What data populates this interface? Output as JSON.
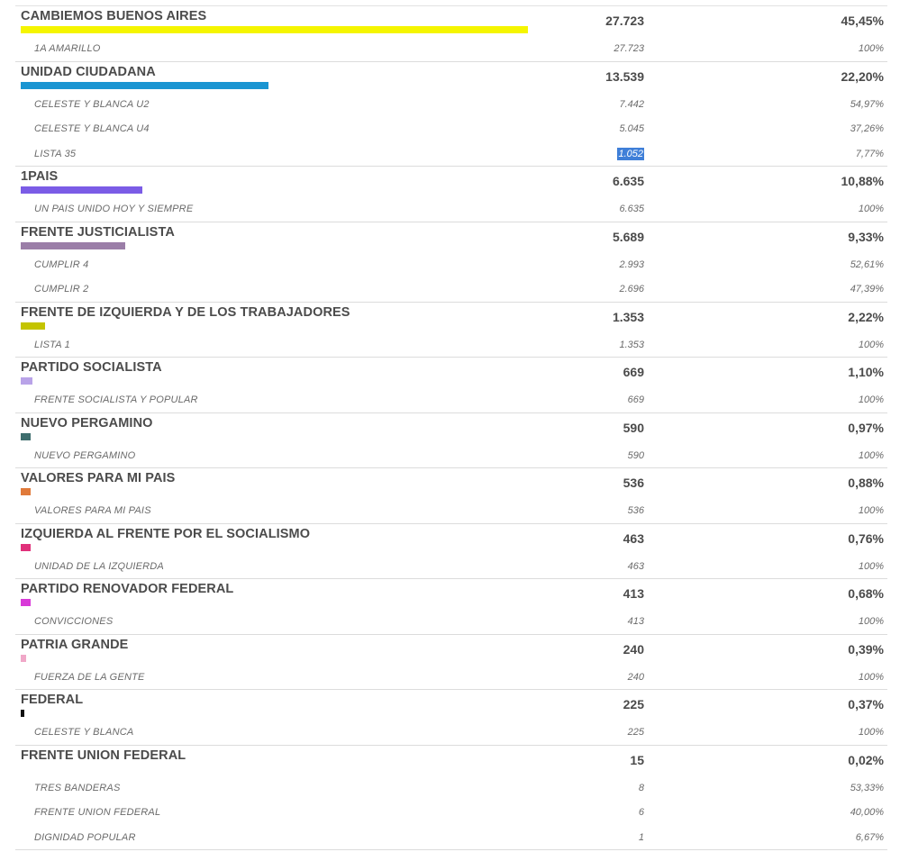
{
  "results": {
    "parties": [
      {
        "name": "CAMBIEMOS BUENOS AIRES",
        "votes": "27.723",
        "pct": "45,45%",
        "pct_value": 45.45,
        "color": "#f5f500",
        "lists": [
          {
            "name": "1A AMARILLO",
            "votes": "27.723",
            "pct": "100%"
          }
        ]
      },
      {
        "name": "UNIDAD CIUDADANA",
        "votes": "13.539",
        "pct": "22,20%",
        "pct_value": 22.2,
        "color": "#1a95d2",
        "lists": [
          {
            "name": "CELESTE Y BLANCA U2",
            "votes": "7.442",
            "pct": "54,97%"
          },
          {
            "name": "CELESTE Y BLANCA U4",
            "votes": "5.045",
            "pct": "37,26%"
          },
          {
            "name": "LISTA 35",
            "votes": "1.052",
            "pct": "7,77%",
            "selected": true
          }
        ]
      },
      {
        "name": "1PAIS",
        "votes": "6.635",
        "pct": "10,88%",
        "pct_value": 10.88,
        "color": "#7b5ce6",
        "lists": [
          {
            "name": "UN PAIS UNIDO HOY Y SIEMPRE",
            "votes": "6.635",
            "pct": "100%"
          }
        ]
      },
      {
        "name": "FRENTE JUSTICIALISTA",
        "votes": "5.689",
        "pct": "9,33%",
        "pct_value": 9.33,
        "color": "#9b7ea8",
        "lists": [
          {
            "name": "CUMPLIR 4",
            "votes": "2.993",
            "pct": "52,61%"
          },
          {
            "name": "CUMPLIR 2",
            "votes": "2.696",
            "pct": "47,39%"
          }
        ]
      },
      {
        "name": "FRENTE DE IZQUIERDA Y DE LOS TRABAJADORES",
        "votes": "1.353",
        "pct": "2,22%",
        "pct_value": 2.22,
        "color": "#c4c400",
        "lists": [
          {
            "name": "LISTA 1",
            "votes": "1.353",
            "pct": "100%"
          }
        ]
      },
      {
        "name": "PARTIDO SOCIALISTA",
        "votes": "669",
        "pct": "1,10%",
        "pct_value": 1.1,
        "color": "#b9a3e8",
        "lists": [
          {
            "name": "FRENTE SOCIALISTA Y POPULAR",
            "votes": "669",
            "pct": "100%"
          }
        ]
      },
      {
        "name": "NUEVO PERGAMINO",
        "votes": "590",
        "pct": "0,97%",
        "pct_value": 0.97,
        "color": "#3e6e6e",
        "lists": [
          {
            "name": "NUEVO PERGAMINO",
            "votes": "590",
            "pct": "100%"
          }
        ]
      },
      {
        "name": "VALORES PARA MI PAIS",
        "votes": "536",
        "pct": "0,88%",
        "pct_value": 0.88,
        "color": "#e07a3a",
        "lists": [
          {
            "name": "VALORES PARA MI PAIS",
            "votes": "536",
            "pct": "100%"
          }
        ]
      },
      {
        "name": "IZQUIERDA AL FRENTE POR EL SOCIALISMO",
        "votes": "463",
        "pct": "0,76%",
        "pct_value": 0.76,
        "color": "#e0307a",
        "lists": [
          {
            "name": "UNIDAD DE LA IZQUIERDA",
            "votes": "463",
            "pct": "100%"
          }
        ]
      },
      {
        "name": "PARTIDO RENOVADOR FEDERAL",
        "votes": "413",
        "pct": "0,68%",
        "pct_value": 0.68,
        "color": "#d83ad8",
        "lists": [
          {
            "name": "CONVICCIONES",
            "votes": "413",
            "pct": "100%"
          }
        ]
      },
      {
        "name": "PATRIA GRANDE",
        "votes": "240",
        "pct": "0,39%",
        "pct_value": 0.39,
        "color": "#f0a8c8",
        "lists": [
          {
            "name": "FUERZA DE LA GENTE",
            "votes": "240",
            "pct": "100%"
          }
        ]
      },
      {
        "name": "FEDERAL",
        "votes": "225",
        "pct": "0,37%",
        "pct_value": 0.37,
        "color": "#111111",
        "lists": [
          {
            "name": "CELESTE Y BLANCA",
            "votes": "225",
            "pct": "100%"
          }
        ]
      },
      {
        "name": "FRENTE UNION FEDERAL",
        "votes": "15",
        "pct": "0,02%",
        "pct_value": 0.02,
        "color": "",
        "lists": [
          {
            "name": "TRES BANDERAS",
            "votes": "8",
            "pct": "53,33%"
          },
          {
            "name": "FRENTE UNION FEDERAL",
            "votes": "6",
            "pct": "40,00%"
          },
          {
            "name": "DIGNIDAD POPULAR",
            "votes": "1",
            "pct": "6,67%"
          }
        ]
      }
    ]
  }
}
